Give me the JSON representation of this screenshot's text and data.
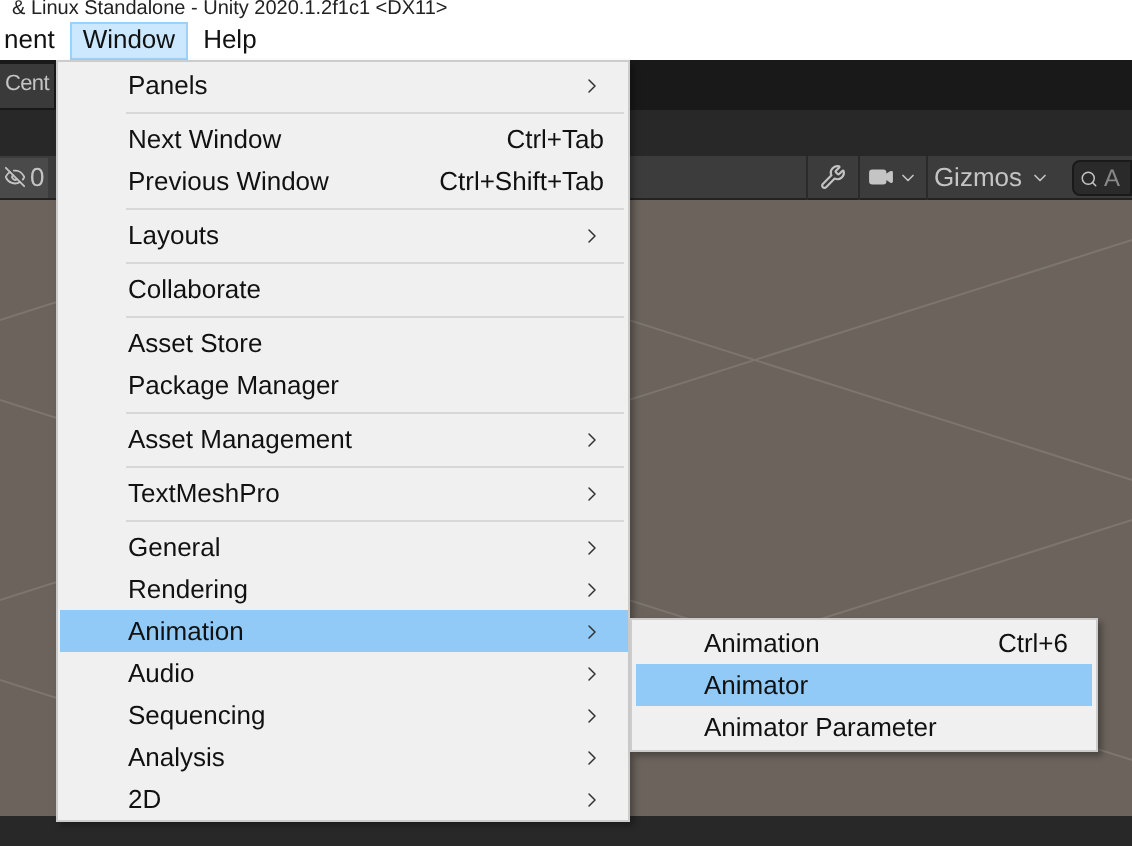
{
  "title_bar": {
    "title": "& Linux Standalone - Unity 2020.1.2f1c1 <DX11>"
  },
  "menu_bar": [
    {
      "label": "nent",
      "selected": false
    },
    {
      "label": "Window",
      "selected": true
    },
    {
      "label": "Help",
      "selected": false
    }
  ],
  "toolbar": {
    "pivot_button": "Cent"
  },
  "scene_toolbar": {
    "hidden_count": "0",
    "gizmos": "Gizmos",
    "search": {
      "placeholder": "A"
    }
  },
  "window_menu": [
    {
      "kind": "item",
      "label": "Panels",
      "submenu": true,
      "selected": false
    },
    {
      "kind": "separator"
    },
    {
      "kind": "item",
      "label": "Next Window",
      "shortcut": "Ctrl+Tab",
      "submenu": false,
      "selected": false
    },
    {
      "kind": "item",
      "label": "Previous Window",
      "shortcut": "Ctrl+Shift+Tab",
      "submenu": false,
      "selected": false
    },
    {
      "kind": "separator"
    },
    {
      "kind": "item",
      "label": "Layouts",
      "submenu": true,
      "selected": false
    },
    {
      "kind": "separator"
    },
    {
      "kind": "item",
      "label": "Collaborate",
      "submenu": false,
      "selected": false
    },
    {
      "kind": "separator"
    },
    {
      "kind": "item",
      "label": "Asset Store",
      "submenu": false,
      "selected": false
    },
    {
      "kind": "item",
      "label": "Package Manager",
      "submenu": false,
      "selected": false
    },
    {
      "kind": "separator"
    },
    {
      "kind": "item",
      "label": "Asset Management",
      "submenu": true,
      "selected": false
    },
    {
      "kind": "separator"
    },
    {
      "kind": "item",
      "label": "TextMeshPro",
      "submenu": true,
      "selected": false
    },
    {
      "kind": "separator"
    },
    {
      "kind": "item",
      "label": "General",
      "submenu": true,
      "selected": false
    },
    {
      "kind": "item",
      "label": "Rendering",
      "submenu": true,
      "selected": false
    },
    {
      "kind": "item",
      "label": "Animation",
      "submenu": true,
      "selected": true
    },
    {
      "kind": "item",
      "label": "Audio",
      "submenu": true,
      "selected": false
    },
    {
      "kind": "item",
      "label": "Sequencing",
      "submenu": true,
      "selected": false
    },
    {
      "kind": "item",
      "label": "Analysis",
      "submenu": true,
      "selected": false
    },
    {
      "kind": "item",
      "label": "2D",
      "submenu": true,
      "selected": false
    }
  ],
  "animation_submenu": [
    {
      "label": "Animation",
      "shortcut": "Ctrl+6",
      "selected": false
    },
    {
      "label": "Animator",
      "selected": true
    },
    {
      "label": "Animator Parameter",
      "selected": false
    }
  ]
}
